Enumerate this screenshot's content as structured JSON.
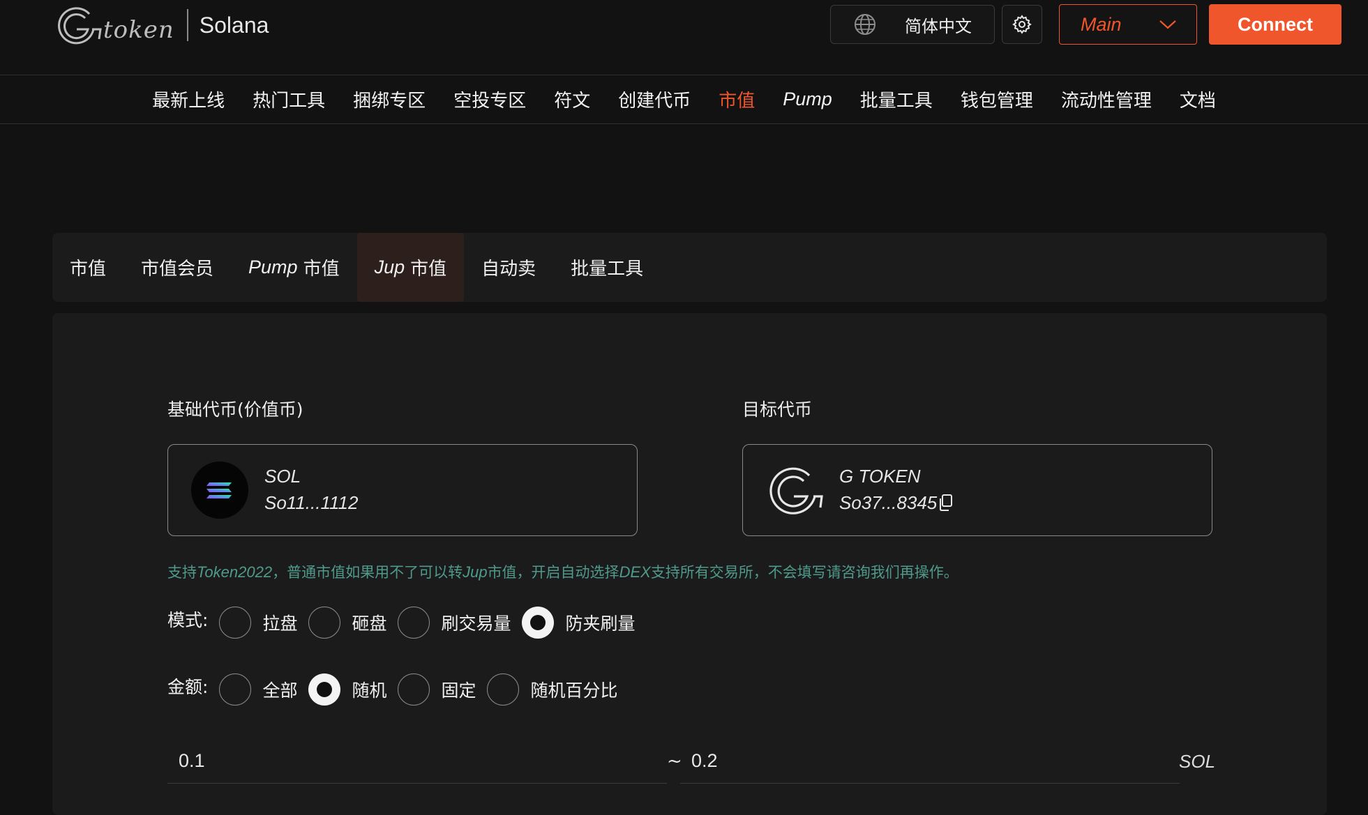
{
  "header": {
    "logo_text": "token",
    "chain_name": "Solana",
    "language": "简体中文",
    "network": "Main",
    "connect_label": "Connect"
  },
  "nav": {
    "items": [
      "最新上线",
      "热门工具",
      "捆绑专区",
      "空投专区",
      "符文",
      "创建代币",
      "市值",
      "Pump",
      "批量工具",
      "钱包管理",
      "流动性管理",
      "文档"
    ],
    "active": "市值"
  },
  "subtabs": {
    "tab0": "市值",
    "tab1": "市值会员",
    "tab2_prefix": "Pump",
    "tab2_suffix": "市值",
    "tab3_prefix": "Jup",
    "tab3_suffix": "市值",
    "tab4": "自动卖",
    "tab5": "批量工具",
    "active": "Jup 市值"
  },
  "base_token": {
    "title": "基础代币(价值币)",
    "symbol": "SOL",
    "address": "So11...1112"
  },
  "target_token": {
    "title": "目标代币",
    "symbol": "G TOKEN",
    "address": "So37...8345"
  },
  "notice": {
    "p1": "支持",
    "p2": "Token2022",
    "p3": "，普通市值如果用不了可以转",
    "p4": "Jup",
    "p5": "市值，开启自动选择",
    "p6": "DEX",
    "p7": "支持所有交易所，不会填写请咨询我们再操作。"
  },
  "mode": {
    "label": "模式:",
    "options": [
      "拉盘",
      "砸盘",
      "刷交易量",
      "防夹刷量"
    ],
    "selected": "防夹刷量"
  },
  "amount": {
    "label": "金额:",
    "options": [
      "全部",
      "随机",
      "固定",
      "随机百分比"
    ],
    "selected": "随机",
    "min": "0.1",
    "max": "0.2",
    "separator": "~",
    "unit": "SOL"
  },
  "colors": {
    "accent": "#f0562c",
    "background": "#121212",
    "panel": "#1b1b1b",
    "notice": "#4f9a8b",
    "active_tab_bg": "#2d1f1c"
  }
}
